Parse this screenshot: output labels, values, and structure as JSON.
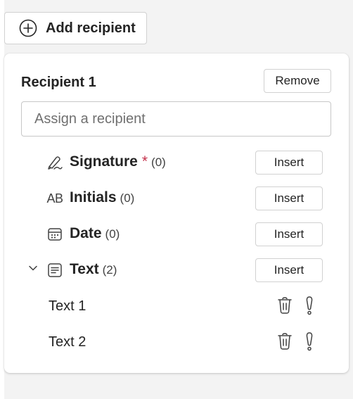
{
  "add_recipient": {
    "label": "Add recipient",
    "icon": "add-circle-icon"
  },
  "recipient": {
    "title": "Recipient 1",
    "remove_label": "Remove",
    "assign_placeholder": "Assign a recipient",
    "fields": [
      {
        "name": "Signature",
        "required_mark": "*",
        "count": "(0)",
        "icon": "signature-pen-icon",
        "insert_label": "Insert"
      },
      {
        "name": "Initials",
        "count": "(0)",
        "icon": "initials-icon",
        "icon_text": "AB",
        "insert_label": "Insert"
      },
      {
        "name": "Date",
        "count": "(0)",
        "icon": "calendar-icon",
        "insert_label": "Insert"
      },
      {
        "name": "Text",
        "count": "(2)",
        "icon": "text-field-icon",
        "insert_label": "Insert",
        "expanded": true,
        "items": [
          {
            "label": "Text 1"
          },
          {
            "label": "Text 2"
          }
        ]
      }
    ]
  },
  "colors": {
    "required": "#c4314b",
    "page_bg": "#f3f3f3",
    "card_bg": "#ffffff",
    "border": "#d1d1d1"
  }
}
